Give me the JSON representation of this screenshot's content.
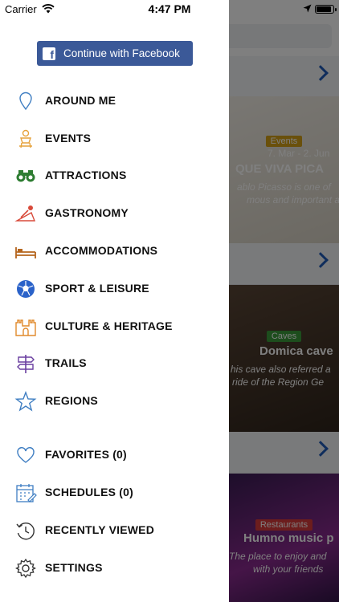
{
  "status_bar": {
    "carrier": "Carrier",
    "time": "4:47 PM",
    "battery_level": 0.9
  },
  "drawer": {
    "facebook_button": "Continue with Facebook",
    "menu": [
      {
        "label": "AROUND ME",
        "icon": "location-pin-icon"
      },
      {
        "label": "EVENTS",
        "icon": "events-icon"
      },
      {
        "label": "ATTRACTIONS",
        "icon": "binoculars-icon"
      },
      {
        "label": "GASTRONOMY",
        "icon": "gastronomy-icon"
      },
      {
        "label": "ACCOMMODATIONS",
        "icon": "bed-icon"
      },
      {
        "label": "SPORT & LEISURE",
        "icon": "soccer-ball-icon"
      },
      {
        "label": "CULTURE & HERITAGE",
        "icon": "castle-icon"
      },
      {
        "label": "TRAILS",
        "icon": "signpost-icon"
      },
      {
        "label": "REGIONS",
        "icon": "star-icon"
      }
    ],
    "secondary_menu": [
      {
        "label": "FAVORITES (0)",
        "icon": "heart-icon"
      },
      {
        "label": "SCHEDULES (0)",
        "icon": "calendar-icon"
      },
      {
        "label": "RECENTLY VIEWED",
        "icon": "history-icon"
      },
      {
        "label": "SETTINGS",
        "icon": "gear-icon"
      }
    ]
  },
  "background": {
    "cards": [
      {
        "badge": "Events",
        "badge_color": "#d4a017",
        "date": "7. Mar - 2. Jun",
        "title": "QUE VIVA PICA",
        "desc_line1": "ablo Picasso is one of",
        "desc_line2": "mous and important a"
      },
      {
        "badge": "Caves",
        "badge_color": "#3a9a3a",
        "title": "Domica cave",
        "desc_line1": "his cave also referred a",
        "desc_line2": "ride of the Region Ge"
      },
      {
        "badge": "Restaurants",
        "badge_color": "#d83a3a",
        "title": "Humno music p",
        "desc_line1": "The place to enjoy and",
        "desc_line2": "with your friends"
      }
    ]
  },
  "colors": {
    "facebook": "#3b5998",
    "accent_blue": "#1f5bb8",
    "icon_orange": "#e08a2c",
    "icon_green": "#2e7d32",
    "icon_purple": "#6a3fa0"
  }
}
